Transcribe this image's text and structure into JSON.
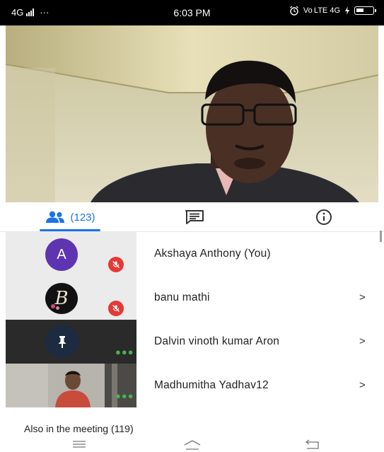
{
  "status_bar": {
    "network": "4G",
    "more": "···",
    "time": "6:03 PM",
    "right_indicators": "Vo LTE 4G"
  },
  "tabs": {
    "people_count": "(123)"
  },
  "participants": [
    {
      "avatar_letter": "A",
      "name": "Akshaya Anthony (You)",
      "muted": true
    },
    {
      "avatar_letter": "B",
      "name": "banu mathi",
      "muted": true,
      "chevron": ">"
    },
    {
      "name": "Dalvin vinoth kumar Aron",
      "chevron": ">"
    },
    {
      "name": "Madhumitha Yadhav12",
      "chevron": ">"
    }
  ],
  "also_in_meeting": "Also in the meeting (119)",
  "colors": {
    "accent": "#1a73e8",
    "mute_badge": "#e53935",
    "avatar_a": "#5e35b1",
    "dots": "#4caf50"
  }
}
